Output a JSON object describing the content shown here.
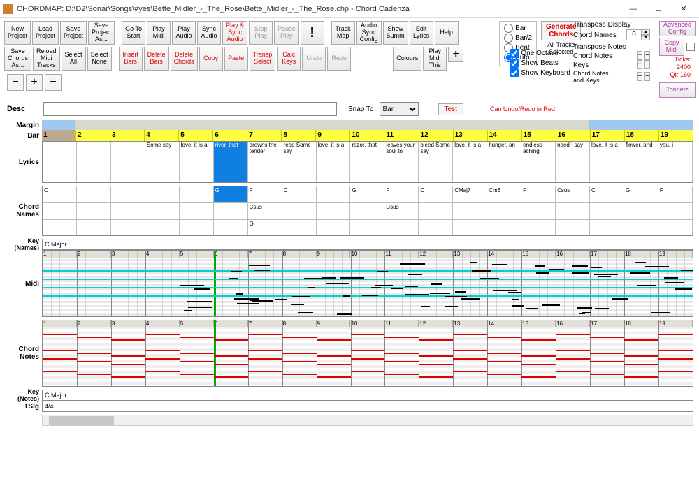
{
  "title": "CHORDMAP: D:\\D2\\Sonar\\Songs\\#yes\\Bette_Midler_-_The_Rose\\Bette_Midler_-_The_Rose.chp - Chord Cadenza",
  "toolbar1": {
    "newProject": "New\nProject",
    "loadProject": "Load\nProject",
    "saveProject": "Save\nProject",
    "saveProjectAs": "Save\nProject\nAs...",
    "goToStart": "Go To\nStart",
    "playMidi": "Play\nMidi",
    "playAudio": "Play\nAudio",
    "syncAudio": "Sync\nAudio",
    "playSyncAudio": "Play &\nSync\nAudio",
    "stopPlay": "Stop\nPlay",
    "pausePlay": "Pause\nPlay",
    "exclaim": "!",
    "trackMap": "Track\nMap",
    "audioSyncConfig": "Audio\nSync\nConfig",
    "showSumm": "Show\nSumm",
    "editLyrics": "Edit\nLyrics",
    "help": "Help"
  },
  "toolbar2": {
    "saveChordsAs": "Save\nChords\nAs...",
    "reloadMidiTracks": "Reload\nMidi\nTracks",
    "selectAll": "Select\nAll",
    "selectNone": "Select\nNone",
    "insertBars": "Insert\nBars",
    "deleteBars": "Delete\nBars",
    "deleteChords": "Delete\nChords",
    "copy": "Copy",
    "paste": "Paste",
    "transpSelect": "Transp\nSelect",
    "calcKeys": "Calc\nKeys",
    "undo": "Undo",
    "redo": "Redo",
    "colours": "Colours",
    "playMidiThis": "Play\nMidi\nThis",
    "plus": "+"
  },
  "radios": {
    "bar": "Bar",
    "bar2": "Bar/2",
    "beat": "Beat",
    "auto": "Auto",
    "selected": "auto"
  },
  "gen": {
    "btn": "Generate\nChords",
    "sel": "All Tracks\nSelected"
  },
  "checks": {
    "oneOctave": "One Octave",
    "showBeats": "Show Beats",
    "showKeyboard": "Show Keyboard"
  },
  "transpose": {
    "displayTitle": "Transpose Display",
    "chordNamesLabel": "Chord Names",
    "chordNamesVal": "0",
    "notesTitle": "Transpose Notes",
    "chordNotes": "Chord Notes",
    "keys": "Keys",
    "both": "Chord Notes\nand Keys"
  },
  "right": {
    "advanced": "Advanced\nConfig",
    "copyMidi": "Copy\nMidi",
    "ticks": "Ticks:  2400",
    "qi": "QI:  160",
    "tonnetz": "Tonnetz"
  },
  "desc": {
    "label": "Desc",
    "snapTo": "Snap To",
    "snapVal": "Bar",
    "test": "Test",
    "undoRedo": "Can Undo/Redo in Red"
  },
  "tracks": {
    "margin": "Margin",
    "bar": "Bar",
    "lyrics": "Lyrics",
    "chordNames": "Chord\nNames",
    "keyNames": "Key\n(Names)",
    "midi": "Midi",
    "chordNotes": "Chord\nNotes",
    "keyNotes": "Key\n(Notes)",
    "tsig": "TSig"
  },
  "bars": [
    "1",
    "2",
    "3",
    "4",
    "5",
    "6",
    "7",
    "8",
    "9",
    "10",
    "11",
    "12",
    "13",
    "14",
    "15",
    "16",
    "17",
    "18",
    "19"
  ],
  "lyrics": [
    "",
    "",
    "",
    "Some say",
    "love, it is a",
    "river, that",
    "drowns the tender",
    "reed Some say",
    "love, it is a",
    "razor, that",
    "leaves your soul to",
    "bleed Some say",
    "love, it is a",
    "hunger, an",
    "endless aching",
    "need I say",
    "love, it is a",
    "flower, and",
    "you, i"
  ],
  "chords1": [
    "C",
    "",
    "",
    "",
    "",
    "G",
    "F",
    "C",
    "",
    "G",
    "F",
    "C",
    "CMaj7",
    "Cm6",
    "F",
    "Csus",
    "C",
    "G",
    "F"
  ],
  "chords2": [
    "",
    "",
    "",
    "",
    "",
    "",
    "Csus",
    "",
    "",
    "",
    "Csus",
    "",
    "",
    "",
    "",
    "",
    "",
    "",
    ""
  ],
  "chords3": [
    "",
    "",
    "",
    "",
    "",
    "",
    "G",
    "",
    "",
    "",
    "",
    "",
    "",
    "",
    "",
    "",
    "",
    "",
    ""
  ],
  "keyName": "C Major",
  "tsigVal": "4/4",
  "selectedBar": 6
}
